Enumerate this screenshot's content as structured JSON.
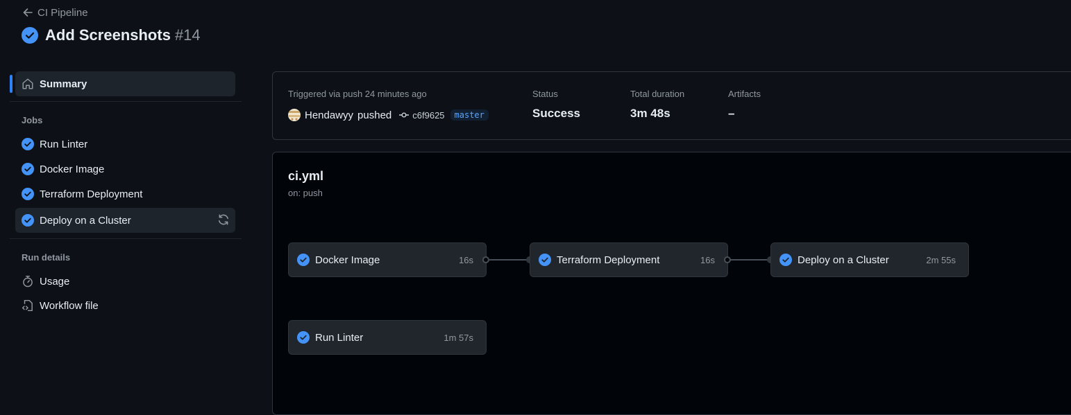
{
  "header": {
    "back_label": "CI Pipeline",
    "run_title": "Add Screenshots",
    "run_number": "#14"
  },
  "sidebar": {
    "summary_label": "Summary",
    "jobs_heading": "Jobs",
    "jobs": [
      {
        "label": "Run Linter",
        "status": "success"
      },
      {
        "label": "Docker Image",
        "status": "success"
      },
      {
        "label": "Terraform Deployment",
        "status": "success"
      },
      {
        "label": "Deploy on a Cluster",
        "status": "success"
      }
    ],
    "details_heading": "Run details",
    "details": [
      {
        "label": "Usage",
        "icon": "stopwatch-icon"
      },
      {
        "label": "Workflow file",
        "icon": "file-code-icon"
      }
    ]
  },
  "summary": {
    "trigger_text": "Triggered via push 24 minutes ago",
    "actor": "Hendawyy",
    "action": "pushed",
    "commit_sha": "c6f9625",
    "branch": "master",
    "status_label": "Status",
    "status_value": "Success",
    "duration_label": "Total duration",
    "duration_value": "3m 48s",
    "artifacts_label": "Artifacts",
    "artifacts_value": "–"
  },
  "workflow": {
    "file": "ci.yml",
    "trigger": "on: push",
    "jobs": [
      {
        "name": "Docker Image",
        "duration": "16s"
      },
      {
        "name": "Terraform Deployment",
        "duration": "16s"
      },
      {
        "name": "Deploy on a Cluster",
        "duration": "2m 55s"
      },
      {
        "name": "Run Linter",
        "duration": "1m 57s"
      }
    ]
  },
  "colors": {
    "background": "#0d1117",
    "accent": "#2f81f7",
    "success": "#4493f8",
    "border": "#30363d"
  }
}
